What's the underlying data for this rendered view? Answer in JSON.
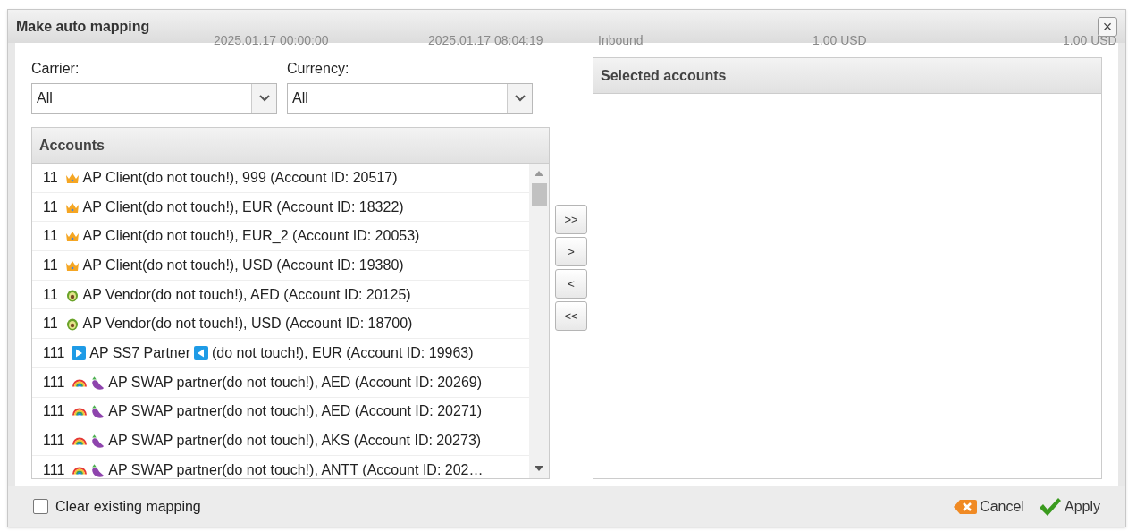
{
  "background_row": [
    "2025.01.17 00:00:00",
    "2025.01.17 08:04:19",
    "Inbound",
    "1.00 USD",
    "1.00 USD"
  ],
  "dialog": {
    "title": "Make auto mapping",
    "close": "×"
  },
  "filters": [
    {
      "label": "Carrier:",
      "value": "All"
    },
    {
      "label": "Currency:",
      "value": "All"
    }
  ],
  "accounts": {
    "title": "Accounts",
    "rows": [
      {
        "segments": [
          {
            "kind": "text",
            "text": "11"
          },
          {
            "kind": "crown"
          },
          {
            "kind": "text",
            "text": "AP Client(do not touch!), 999 (Account ID: 20517)"
          }
        ]
      },
      {
        "segments": [
          {
            "kind": "text",
            "text": "11"
          },
          {
            "kind": "crown"
          },
          {
            "kind": "text",
            "text": "AP Client(do not touch!), EUR (Account ID: 18322)"
          }
        ]
      },
      {
        "segments": [
          {
            "kind": "text",
            "text": "11"
          },
          {
            "kind": "crown"
          },
          {
            "kind": "text",
            "text": "AP Client(do not touch!), EUR_2 (Account ID: 20053)"
          }
        ]
      },
      {
        "segments": [
          {
            "kind": "text",
            "text": "11"
          },
          {
            "kind": "crown"
          },
          {
            "kind": "text",
            "text": "AP Client(do not touch!), USD (Account ID: 19380)"
          }
        ]
      },
      {
        "segments": [
          {
            "kind": "text",
            "text": "11"
          },
          {
            "kind": "avocado"
          },
          {
            "kind": "text",
            "text": "AP Vendor(do not touch!), AED (Account ID: 20125)"
          }
        ]
      },
      {
        "segments": [
          {
            "kind": "text",
            "text": "11"
          },
          {
            "kind": "avocado"
          },
          {
            "kind": "text",
            "text": "AP Vendor(do not touch!), USD (Account ID: 18700)"
          }
        ]
      },
      {
        "segments": [
          {
            "kind": "text",
            "text": "111"
          },
          {
            "kind": "play"
          },
          {
            "kind": "text",
            "text": "AP SS7 Partner"
          },
          {
            "kind": "reverse"
          },
          {
            "kind": "text",
            "text": "(do not touch!), EUR (Account ID: 19963)"
          }
        ]
      },
      {
        "segments": [
          {
            "kind": "text",
            "text": "111"
          },
          {
            "kind": "rainbow"
          },
          {
            "kind": "eggplant"
          },
          {
            "kind": "text",
            "text": "AP SWAP partner(do not touch!), AED (Account ID: 20269)"
          }
        ]
      },
      {
        "segments": [
          {
            "kind": "text",
            "text": "111"
          },
          {
            "kind": "rainbow"
          },
          {
            "kind": "eggplant"
          },
          {
            "kind": "text",
            "text": "AP SWAP partner(do not touch!), AED (Account ID: 20271)"
          }
        ]
      },
      {
        "segments": [
          {
            "kind": "text",
            "text": "111"
          },
          {
            "kind": "rainbow"
          },
          {
            "kind": "eggplant"
          },
          {
            "kind": "text",
            "text": "AP SWAP partner(do not touch!), AKS (Account ID: 20273)"
          }
        ]
      },
      {
        "segments": [
          {
            "kind": "text",
            "text": "111"
          },
          {
            "kind": "rainbow"
          },
          {
            "kind": "eggplant"
          },
          {
            "kind": "text",
            "text": "AP SWAP partner(do not touch!), ANTT (Account ID: 202…"
          }
        ]
      }
    ]
  },
  "move_buttons": [
    ">>",
    ">",
    "<",
    "<<"
  ],
  "selected": {
    "title": "Selected accounts"
  },
  "footer": {
    "clear_mapping": {
      "label": "Clear existing mapping",
      "checked": false
    },
    "cancel": "Cancel",
    "apply": "Apply"
  }
}
